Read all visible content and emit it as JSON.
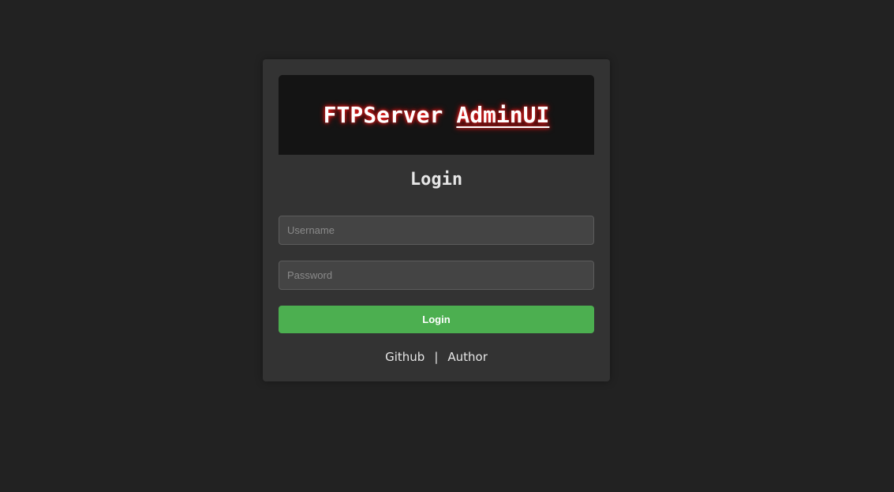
{
  "banner": {
    "title_part1": "FTPServer",
    "title_part2": "AdminUI",
    "glow_color": "#ff2a2a"
  },
  "login": {
    "heading": "Login",
    "username_placeholder": "Username",
    "username_value": "",
    "password_placeholder": "Password",
    "password_value": "",
    "submit_label": "Login",
    "submit_color": "#4caf50"
  },
  "footer": {
    "github_label": "Github",
    "separator": "|",
    "author_label": "Author"
  }
}
